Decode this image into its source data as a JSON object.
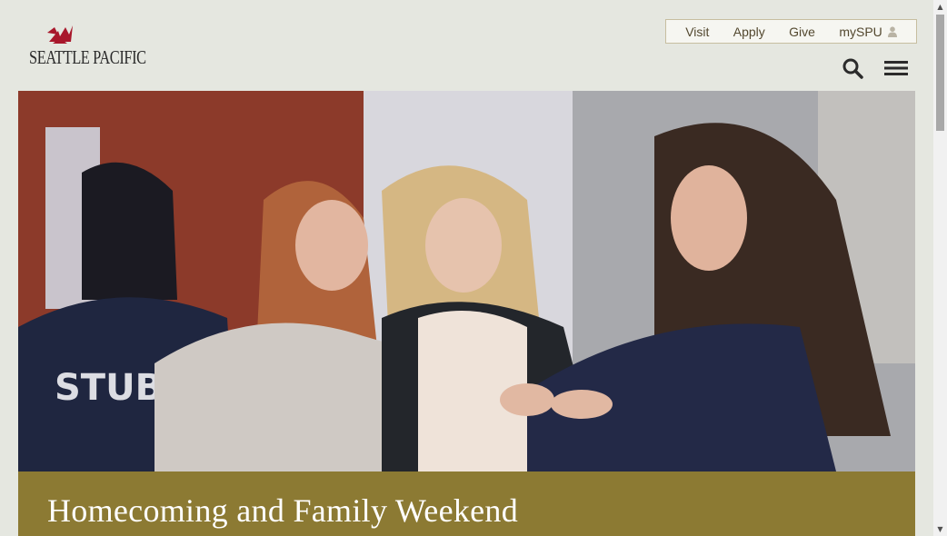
{
  "brand": {
    "name": "SEATTLE PACIFIC",
    "accent": "#a8172b"
  },
  "utility_nav": {
    "items": [
      {
        "label": "Visit"
      },
      {
        "label": "Apply"
      },
      {
        "label": "Give"
      },
      {
        "label": "mySPU",
        "icon": "user-icon"
      }
    ]
  },
  "header_icons": [
    "search-icon",
    "menu-icon"
  ],
  "hero": {
    "caption": "Homecoming and Family Weekend",
    "caption_bg": "#8c7a33",
    "shirt_text": "STUB"
  },
  "colors": {
    "page_bg": "#e5e7e0",
    "nav_text": "#53482f"
  }
}
